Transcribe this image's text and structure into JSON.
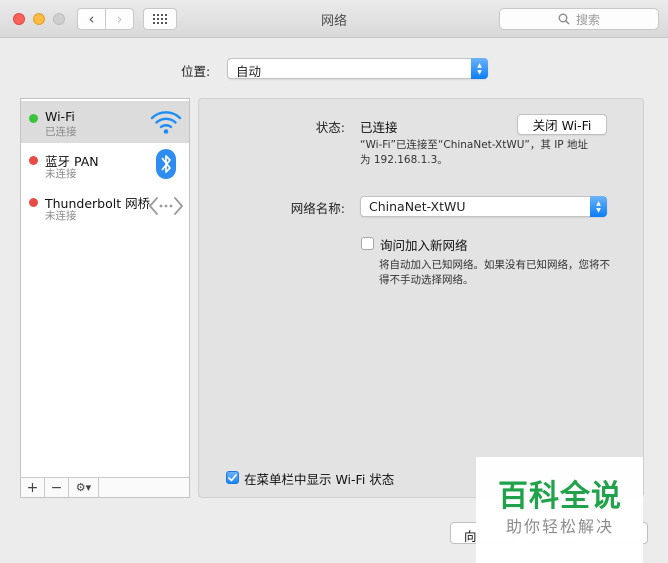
{
  "window": {
    "title": "网络"
  },
  "toolbar": {
    "back": "‹",
    "forward": "›",
    "search_placeholder": "搜索"
  },
  "location": {
    "label": "位置:",
    "value": "自动"
  },
  "services": [
    {
      "name": "Wi-Fi",
      "status": "已连接",
      "status_color": "#3cc23c"
    },
    {
      "name": "蓝牙 PAN",
      "status": "未连接",
      "status_color": "#e84a45"
    },
    {
      "name": "Thunderbolt 网桥",
      "status": "未连接",
      "status_color": "#e84a45"
    }
  ],
  "sidebar_bottom": {
    "add": "+",
    "remove": "−",
    "gear": "⚙▾"
  },
  "detail": {
    "status_label": "状态:",
    "status_value": "已连接",
    "turn_off_button": "关闭 Wi-Fi",
    "status_desc_line1": "“Wi-Fi”已连接至“ChinaNet-XtWU”，其 IP 地址",
    "status_desc_line2": "为 192.168.1.3。",
    "network_name_label": "网络名称:",
    "network_name_value": "ChinaNet-XtWU",
    "ask_join_label": "询问加入新网络",
    "ask_join_checked": false,
    "ask_join_desc_line1": "将自动加入已知网络。如果没有已知网络，您将不",
    "ask_join_desc_line2": "得不手动选择网络。",
    "show_in_menubar_label": "在菜单栏中显示 Wi-Fi 状态",
    "show_in_menubar_checked": true
  },
  "footer": {
    "advanced_button": "向"
  },
  "watermark": {
    "title": "百科全说",
    "subtitle": "助你轻松解决"
  },
  "colors": {
    "accent": "#1a84f7",
    "watermark_green": "#1fa24a"
  }
}
